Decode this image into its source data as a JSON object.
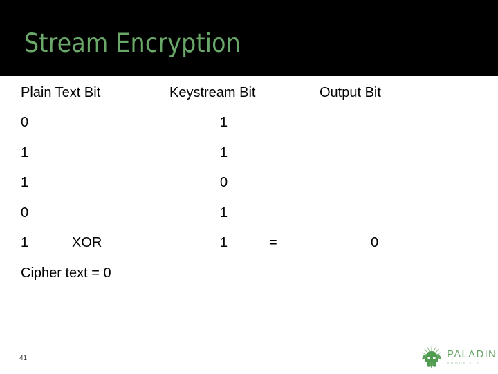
{
  "slide": {
    "title": "Stream Encryption",
    "title_color": "#6aa86a",
    "band_color": "#000000",
    "background": "#ffffff",
    "page_number": "41"
  },
  "table": {
    "headers": [
      "Plain Text Bit",
      "Keystream Bit",
      "Output Bit"
    ],
    "rows": [
      {
        "plain": "0",
        "operator": "",
        "keystream": "1",
        "equals": "",
        "output": ""
      },
      {
        "plain": "1",
        "operator": "",
        "keystream": "1",
        "equals": "",
        "output": ""
      },
      {
        "plain": "1",
        "operator": "",
        "keystream": "0",
        "equals": "",
        "output": ""
      },
      {
        "plain": "0",
        "operator": "",
        "keystream": "1",
        "equals": "",
        "output": ""
      },
      {
        "plain": "1",
        "operator": "XOR",
        "keystream": "1",
        "equals": "=",
        "output": "0"
      }
    ],
    "result_line": "Cipher text = 0"
  },
  "logo": {
    "name": "PALADIN",
    "subtitle": "GROUP LLC",
    "color": "#66a266",
    "icon": "paladin-helmet-icon"
  }
}
